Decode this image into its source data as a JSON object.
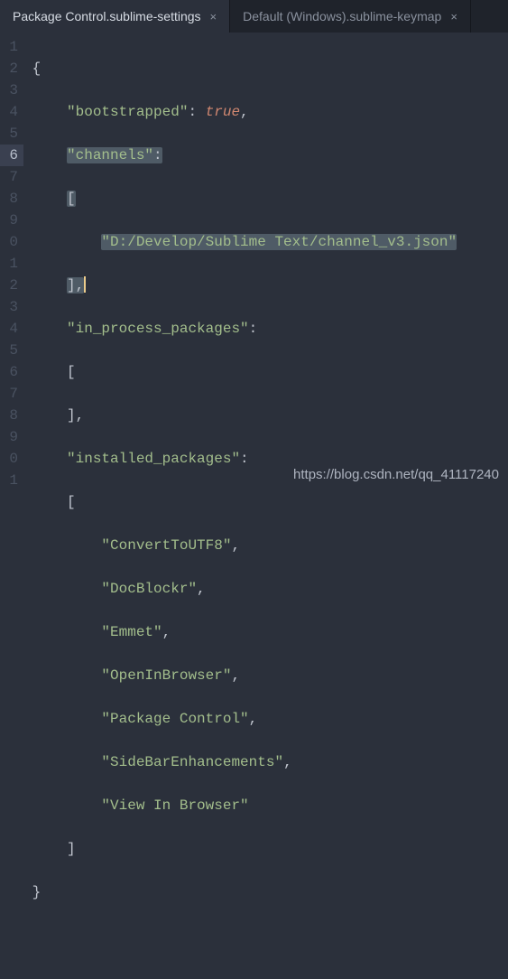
{
  "tabs": [
    {
      "label": "Package Control.sublime-settings",
      "active": true
    },
    {
      "label": "Default (Windows).sublime-keymap",
      "active": false
    }
  ],
  "gutter_lines": [
    "1",
    "2",
    "3",
    "4",
    "5",
    "6",
    "7",
    "8",
    "9",
    "0",
    "1",
    "2",
    "3",
    "4",
    "5",
    "6",
    "7",
    "8",
    "9",
    "0",
    "1"
  ],
  "highlighted_gutter_index": 5,
  "code": {
    "key_bootstrapped": "\"bootstrapped\"",
    "val_true": "true",
    "key_channels": "\"channels\"",
    "val_channel_path": "\"D:/Develop/Sublime Text/channel_v3.json\"",
    "key_in_process": "\"in_process_packages\"",
    "key_installed": "\"installed_packages\"",
    "pkg_0": "\"ConvertToUTF8\"",
    "pkg_1": "\"DocBlockr\"",
    "pkg_2": "\"Emmet\"",
    "pkg_3": "\"OpenInBrowser\"",
    "pkg_4": "\"Package Control\"",
    "pkg_5": "\"SideBarEnhancements\"",
    "pkg_6": "\"View In Browser\"",
    "brace_open": "{",
    "brace_close": "}",
    "bracket_open": "[",
    "bracket_close": "]",
    "bracket_close_comma": "],",
    "colon": ":",
    "colon_space": ": ",
    "comma": ","
  },
  "watermark": "https://blog.csdn.net/qq_41117240"
}
